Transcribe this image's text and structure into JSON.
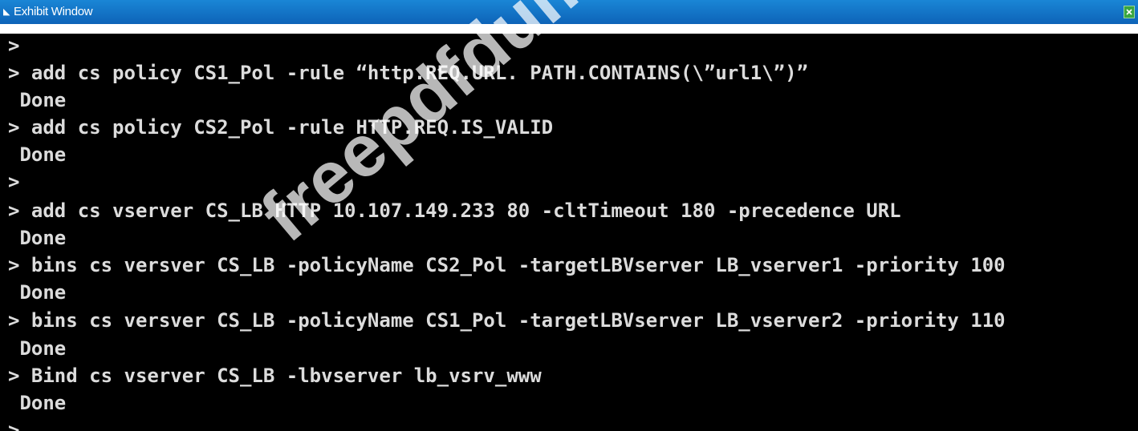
{
  "window": {
    "title": "Exhibit Window",
    "app_icon": "exhibit-window-icon",
    "close_icon": "close-icon",
    "title_bar_color": "#0d63b8",
    "close_button_color": "#3aa640"
  },
  "console": {
    "lines": [
      ">",
      "> add cs policy CS1_Pol -rule “http.REQ.URL. PATH.CONTAINS(\\”url1\\”)”",
      " Done",
      "> add cs policy CS2_Pol -rule HTTP.REQ.IS_VALID",
      " Done",
      ">",
      "> add cs vserver CS_LB HTTP 10.107.149.233 80 -cltTimeout 180 -precedence URL",
      " Done",
      "> bins cs versver CS_LB -policyName CS2_Pol -targetLBVserver LB_vserver1 -priority 100",
      " Done",
      "> bins cs versver CS_LB -policyName CS1_Pol -targetLBVserver LB_vserver2 -priority 110",
      " Done",
      "> Bind cs vserver CS_LB -lbvserver lb_vsrv_www",
      " Done",
      ">"
    ],
    "text_color": "#dcdcdc",
    "background_color": "#000000"
  },
  "watermark": {
    "text": "freepdfdumps.com"
  }
}
